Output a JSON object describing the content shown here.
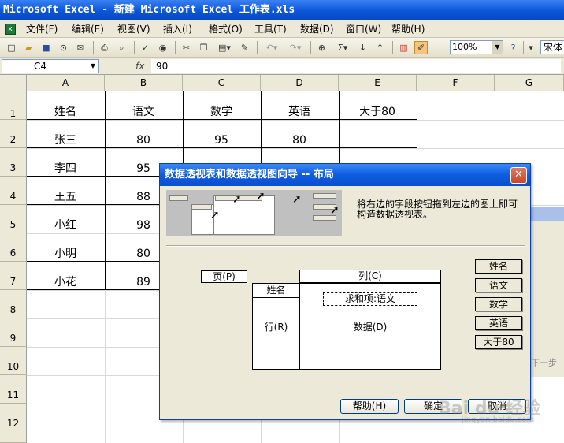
{
  "window": {
    "title": "Microsoft Excel - 新建 Microsoft Excel 工作表.xls"
  },
  "menu": [
    "文件(F)",
    "编辑(E)",
    "视图(V)",
    "插入(I)",
    "格式(O)",
    "工具(T)",
    "数据(D)",
    "窗口(W)",
    "帮助(H)"
  ],
  "toolbar": {
    "zoom": "100%",
    "font": "宋体"
  },
  "formula_bar": {
    "name_box": "C4",
    "fx": "fx",
    "value": "90"
  },
  "sheet": {
    "columns": [
      "A",
      "B",
      "C",
      "D",
      "E",
      "F",
      "G"
    ],
    "rows": [
      "1",
      "2",
      "3",
      "4",
      "5",
      "6",
      "7",
      "8",
      "9",
      "10",
      "11",
      "12"
    ],
    "headers": [
      "姓名",
      "语文",
      "数学",
      "英语",
      "大于80"
    ],
    "cells": [
      [
        "张三",
        "80",
        "95",
        "80"
      ],
      [
        "李四",
        "95"
      ],
      [
        "王五",
        "88"
      ],
      [
        "小红",
        "98"
      ],
      [
        "小明",
        "80"
      ],
      [
        "小花",
        "89"
      ]
    ]
  },
  "background_window": {
    "text": "下一步"
  },
  "dialog": {
    "title": "数据透视表和数据透视图向导 -- 布局",
    "close": "✕",
    "instructions": "将右边的字段按钮拖到左边的图上即可构造数据透视表。",
    "page_area": "页(P)",
    "column_area": "列(C)",
    "row_field": "姓名",
    "row_area": "行(R)",
    "data_field": "求和项:语文",
    "data_area": "数据(D)",
    "field_buttons": [
      "姓名",
      "语文",
      "数学",
      "英语",
      "大于80"
    ],
    "buttons": {
      "help": "帮助(H)",
      "ok": "确定",
      "cancel": "取消"
    }
  },
  "watermark": {
    "main": "Bai du 经验",
    "sub": "jingyan.baidu.com"
  }
}
